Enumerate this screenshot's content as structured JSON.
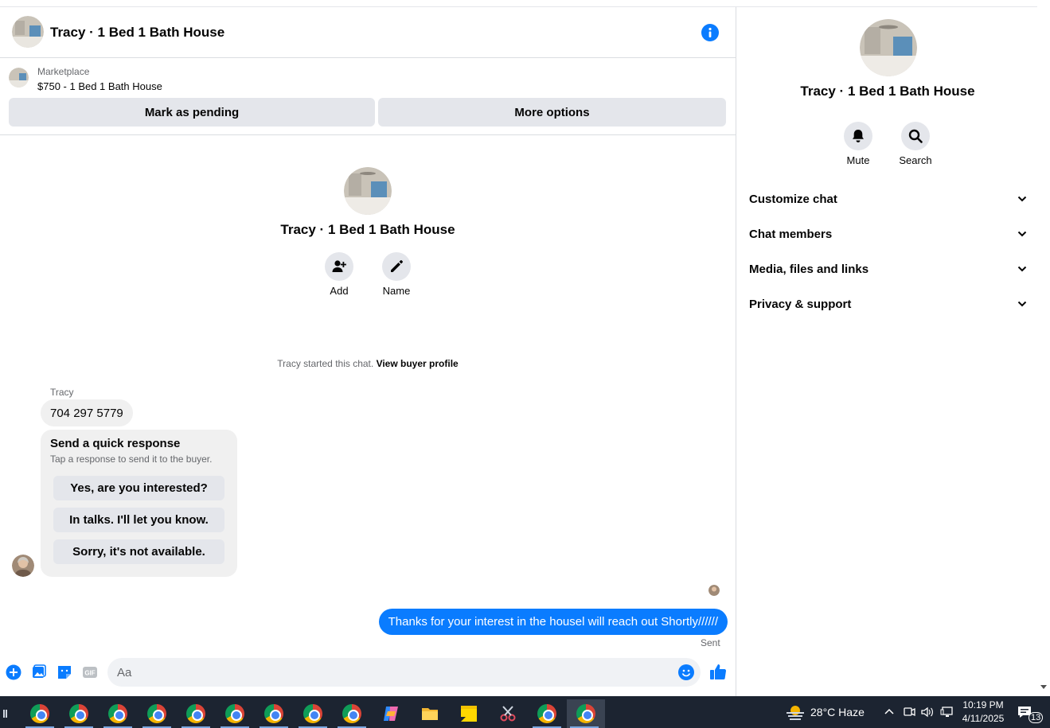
{
  "chat": {
    "title": "Tracy · 1 Bed 1 Bath House",
    "listing": {
      "source": "Marketplace",
      "price_title": "$750 - 1 Bed 1 Bath House",
      "mark_pending_label": "Mark as pending",
      "more_options_label": "More options"
    },
    "intro": {
      "name": "Tracy · 1 Bed 1 Bath House",
      "add_label": "Add",
      "name_label": "Name"
    },
    "started_text": "Tracy started this chat.",
    "view_profile_label": "View buyer profile",
    "messages": {
      "sender": "Tracy",
      "incoming_text": "704 297 5779",
      "outgoing_text": "Thanks for your interest in the housel will reach out Shortly//////",
      "status": "Sent"
    },
    "quick_response": {
      "title": "Send a quick response",
      "subtitle": "Tap a response to send it to the buyer.",
      "options": [
        "Yes, are you interested?",
        "In talks. I'll let you know.",
        "Sorry, it's not available."
      ]
    },
    "composer": {
      "placeholder": "Aa"
    }
  },
  "panel": {
    "name": "Tracy · 1 Bed 1 Bath House",
    "mute_label": "Mute",
    "search_label": "Search",
    "sections": [
      "Customize chat",
      "Chat members",
      "Media, files and links",
      "Privacy & support"
    ]
  },
  "taskbar": {
    "weather": "28°C  Haze",
    "time": "10:19 PM",
    "date": "4/11/2025",
    "notifications": "13"
  },
  "colors": {
    "accent": "#0a7cff",
    "bubble_gray": "#f0f0f0",
    "button_gray": "#e4e6eb",
    "taskbar": "#1c2431"
  }
}
